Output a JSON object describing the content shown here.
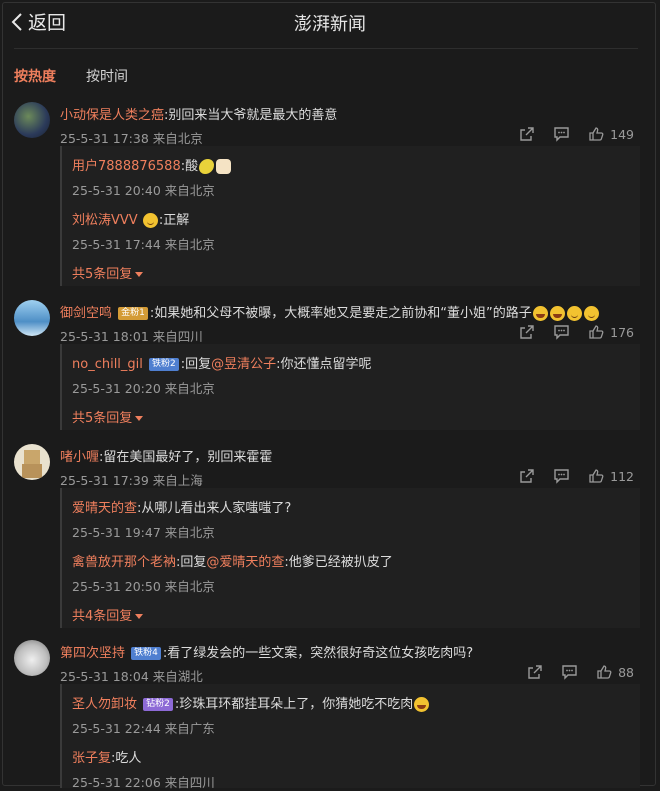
{
  "header": {
    "back_label": "返回",
    "title": "澎湃新闻"
  },
  "sort_tabs": {
    "hot": "按热度",
    "time": "按时间"
  },
  "comments": [
    {
      "user": "小动保是人类之癌",
      "text": ":别回来当大爷就是最大的善意",
      "time": "25-5-31 17:38",
      "location": "来自北京",
      "likes": "149",
      "replies": [
        {
          "user": "用户7888876588",
          "text": ":酸",
          "time": "25-5-31 20:40",
          "location": "来自北京"
        },
        {
          "user": "刘松涛VVV",
          "text": ":正解",
          "time": "25-5-31 17:44",
          "location": "来自北京"
        }
      ],
      "more": "共5条回复"
    },
    {
      "user": "御剑空鸣",
      "badge": "金粉1",
      "text": ":如果她和父母不被曝，大概率她又是要走之前协和“董小姐”的路子",
      "time": "25-5-31 18:01",
      "location": "来自四川",
      "likes": "176",
      "replies": [
        {
          "user": "no_chill_gil",
          "badge": "铁粉2",
          "text_prefix": ":回复",
          "at": "@昱清公子",
          "text": ":你还懂点留学呢",
          "time": "25-5-31 20:20",
          "location": "来自北京"
        }
      ],
      "more": "共5条回复"
    },
    {
      "user": "啫小喱",
      "text": ":留在美国最好了，别回来霍霍",
      "time": "25-5-31 17:39",
      "location": "来自上海",
      "likes": "112",
      "replies": [
        {
          "user": "爱晴天的查",
          "text": ":从哪儿看出来人家嗤嗤了?",
          "time": "25-5-31 19:47",
          "location": "来自北京"
        },
        {
          "user": "禽兽放开那个老衲",
          "text_prefix": ":回复",
          "at": "@爱晴天的查",
          "text": ":他爹已经被扒皮了",
          "time": "25-5-31 20:50",
          "location": "来自北京"
        }
      ],
      "more": "共4条回复"
    },
    {
      "user": "第四次坚持",
      "badge": "铁粉4",
      "text": ":看了绿发会的一些文案，突然很好奇这位女孩吃肉吗?",
      "time": "25-5-31 18:04",
      "location": "来自湖北",
      "likes": "88",
      "replies": [
        {
          "user": "圣人勿卸妆",
          "badge": "钻粉2",
          "text": ":珍珠耳环都挂耳朵上了，你猜她吃不吃肉",
          "time": "25-5-31 22:44",
          "location": "来自广东"
        },
        {
          "user": "张子复",
          "text": ":吃人",
          "time": "25-5-31 22:06",
          "location": "来自四川"
        }
      ]
    }
  ],
  "colors": {
    "accent": "#ef7f5d",
    "background": "#1b1b1b",
    "muted": "#9a9a9a"
  }
}
